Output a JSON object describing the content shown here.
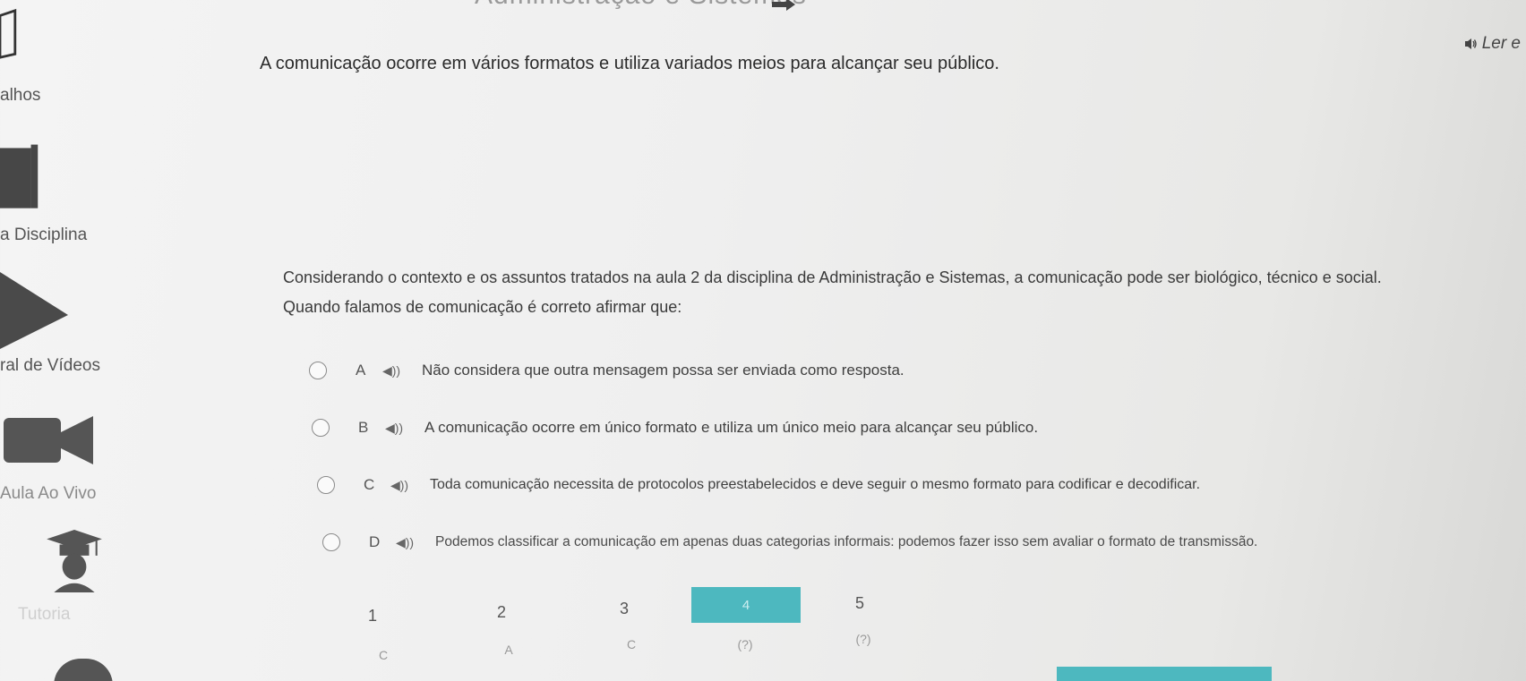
{
  "header": {
    "course_title": "Administração e Sistemas",
    "listen_label": "Ler e"
  },
  "intro_text": "A comunicação ocorre em vários formatos e utiliza variados meios para alcançar seu público.",
  "sidebar": {
    "items": [
      {
        "label": "alhos",
        "icon": "book-icon"
      },
      {
        "label": "a Disciplina",
        "icon": "notebook-icon"
      },
      {
        "label": "ral de Vídeos",
        "icon": "play-icon"
      },
      {
        "label": "Aula Ao Vivo",
        "icon": "video-camera-icon"
      },
      {
        "label": "Tutoria",
        "icon": "graduate-icon"
      }
    ]
  },
  "question": {
    "line1": "Considerando o contexto e os assuntos tratados na aula 2 da disciplina de Administração e Sistemas, a comunicação pode ser biológico, técnico e social.",
    "line2": "Quando falamos de comunicação é correto afirmar que:"
  },
  "options": [
    {
      "letter": "A",
      "text": "Não considera que outra mensagem possa ser enviada como resposta."
    },
    {
      "letter": "B",
      "text": "A comunicação ocorre em único formato e utiliza um único meio para alcançar seu público."
    },
    {
      "letter": "C",
      "text": "Toda comunicação necessita de protocolos preestabelecidos e deve seguir o mesmo formato para codificar e decodificar."
    },
    {
      "letter": "D",
      "text": "Podemos classificar a comunicação em apenas duas categorias informais: podemos fazer isso sem avaliar o formato de transmissão."
    }
  ],
  "pagination": {
    "pages": [
      "1",
      "2",
      "3",
      "4",
      "5"
    ],
    "answers": [
      "C",
      "A",
      "C",
      "(?)",
      "(?)"
    ],
    "current": "4"
  },
  "colors": {
    "accent": "#4db8bf",
    "text": "#333333"
  }
}
